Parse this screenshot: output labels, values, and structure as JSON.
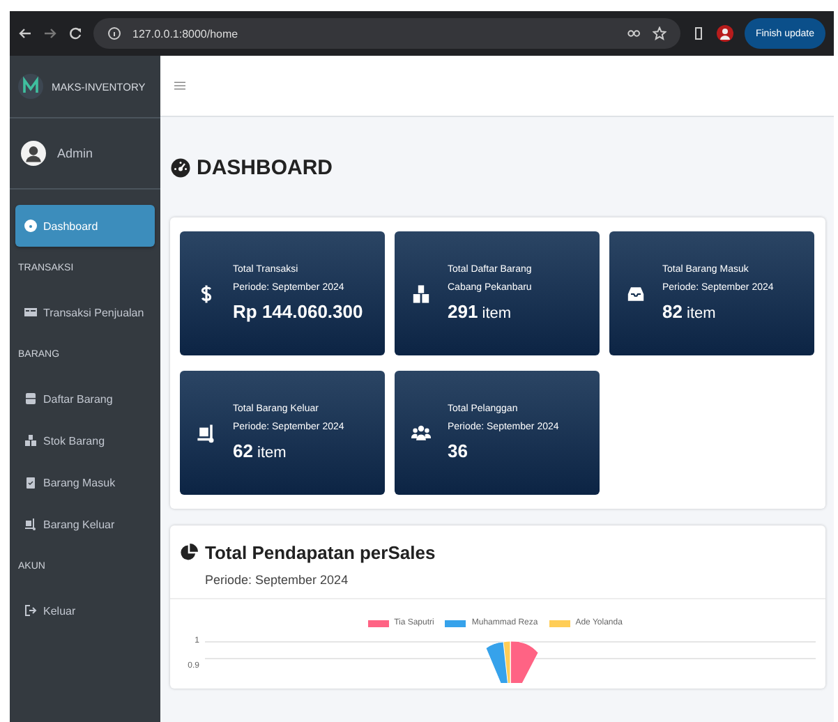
{
  "browser": {
    "url": "127.0.0.1:8000/home",
    "update_button": "Finish update"
  },
  "sidebar": {
    "brand": "MAKS-INVENTORY",
    "user": "Admin",
    "items": [
      {
        "kind": "link",
        "label": "Dashboard",
        "selected": true
      },
      {
        "kind": "header",
        "label": "TRANSAKSI"
      },
      {
        "kind": "link",
        "label": "Transaksi Penjualan",
        "selected": false
      },
      {
        "kind": "header",
        "label": "BARANG"
      },
      {
        "kind": "link",
        "label": "Daftar Barang",
        "selected": false
      },
      {
        "kind": "link",
        "label": "Stok Barang",
        "selected": false
      },
      {
        "kind": "link",
        "label": "Barang Masuk",
        "selected": false
      },
      {
        "kind": "link",
        "label": "Barang Keluar",
        "selected": false
      },
      {
        "kind": "header",
        "label": "AKUN"
      },
      {
        "kind": "link",
        "label": "Keluar",
        "selected": false
      }
    ]
  },
  "page_title": "DASHBOARD",
  "stats": [
    {
      "title": "Total Transaksi",
      "subtitle": "Periode: September 2024",
      "value": "Rp 144.060.300"
    },
    {
      "title": "Total Daftar Barang",
      "subtitle": "Cabang Pekanbaru",
      "value": "291",
      "unit": "item"
    },
    {
      "title": "Total Barang Masuk",
      "subtitle": "Periode: September 2024",
      "value": "82",
      "unit": "item"
    },
    {
      "title": "Total Barang Keluar",
      "subtitle": "Periode: September 2024",
      "value": "62",
      "unit": "item"
    },
    {
      "title": "Total Pelanggan",
      "subtitle": "Periode: September 2024",
      "value": "36"
    }
  ],
  "chart_card": {
    "title": "Total Pendapatan perSales",
    "subtitle": "Periode: September 2024",
    "legend": [
      {
        "label": "Tia Saputri",
        "color": "#ff6384"
      },
      {
        "label": "Muhammad Reza",
        "color": "#36a2eb"
      },
      {
        "label": "Ade Yolanda",
        "color": "#ffcd56"
      }
    ],
    "y_ticks": [
      "1",
      "0.9"
    ]
  }
}
